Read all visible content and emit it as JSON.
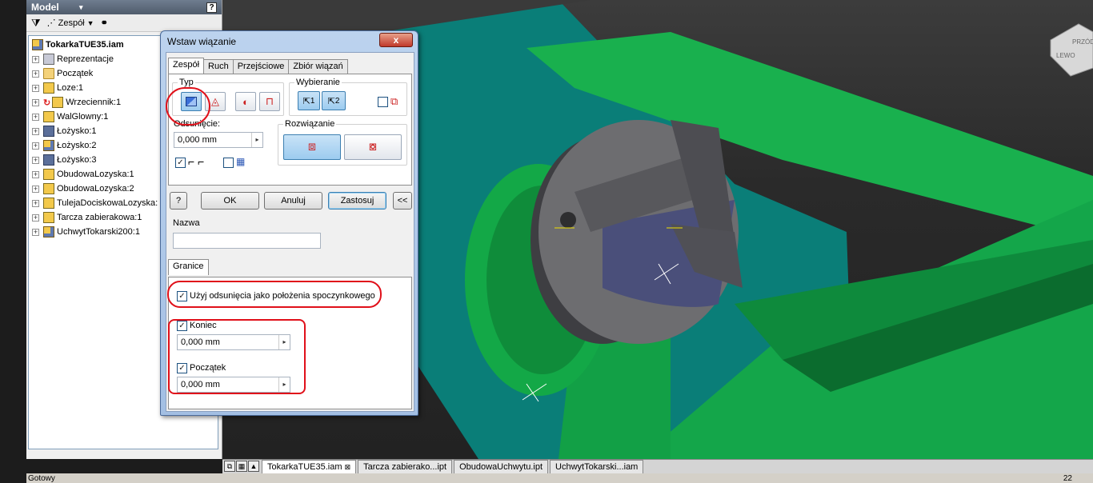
{
  "browser": {
    "title": "Model",
    "toolbar_label": "Zespół",
    "tree": [
      {
        "label": "TokarkaTUE35.iam",
        "icon": "assembly-icon",
        "root": true
      },
      {
        "label": "Reprezentacje",
        "icon": "representations-icon"
      },
      {
        "label": "Początek",
        "icon": "folder-icon"
      },
      {
        "label": "Loze:1",
        "icon": "part-icon"
      },
      {
        "label": "Wrzeciennik:1",
        "icon": "part-icon"
      },
      {
        "label": "WalGlowny:1",
        "icon": "part-icon"
      },
      {
        "label": "Łożysko:1",
        "icon": "bearing-icon"
      },
      {
        "label": "Łożysko:2",
        "icon": "assembly-icon"
      },
      {
        "label": "Łożysko:3",
        "icon": "bearing-icon"
      },
      {
        "label": "ObudowaLozyska:1",
        "icon": "part-icon"
      },
      {
        "label": "ObudowaLozyska:2",
        "icon": "part-icon"
      },
      {
        "label": "TulejaDociskowaLozyska:",
        "icon": "part-icon"
      },
      {
        "label": "Tarcza zabierakowa:1",
        "icon": "part-icon"
      },
      {
        "label": "UchwytTokarski200:1",
        "icon": "assembly-icon"
      }
    ]
  },
  "dialog": {
    "title": "Wstaw wiązanie",
    "close": "x",
    "tabs": [
      "Zespół",
      "Ruch",
      "Przejściowe",
      "Zbiór wiązań"
    ],
    "type_label": "Typ",
    "selection_label": "Wybieranie",
    "sel1": "1",
    "sel2": "2",
    "offset_label": "Odsunięcie:",
    "offset_value": "0,000 mm",
    "solution_label": "Rozwiązanie",
    "ok": "OK",
    "cancel": "Anuluj",
    "apply": "Zastosuj",
    "more": "<<",
    "help": "?",
    "name_label": "Nazwa",
    "name_value": "",
    "limits_tab": "Granice",
    "use_offset_label": "Użyj odsunięcia jako położenia spoczynkowego",
    "end_label": "Koniec",
    "end_value": "0,000 mm",
    "start_label": "Początek",
    "start_value": "0,000 mm"
  },
  "doc_tabs": [
    "TokarkaTUE35.iam",
    "Tarcza zabierako...ipt",
    "ObudowaUchwytu.ipt",
    "UchwytTokarski...iam"
  ],
  "status": {
    "text": "Gotowy",
    "count": "22"
  },
  "viewcube_labels": [
    "PRZÓD",
    "LEWO"
  ],
  "colors": {
    "base_teal": "#0a7e78",
    "green": "#11a84a",
    "chuck": "#6d6d70",
    "annotation": "#e0101a"
  }
}
